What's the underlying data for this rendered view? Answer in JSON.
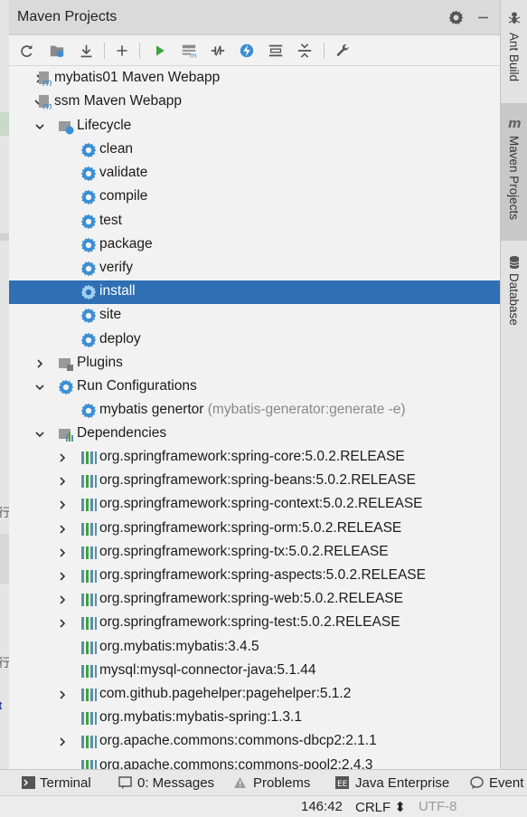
{
  "panel": {
    "title": "Maven Projects",
    "title_icons": [
      "gear-icon",
      "minimize-icon"
    ],
    "toolbar": [
      "reimport-icon",
      "generate-sources-icon",
      "download-icon",
      "add-icon",
      "run-icon",
      "execute-goal-icon",
      "toggle-offline-icon",
      "skip-tests-icon",
      "show-dependencies-icon",
      "collapse-all-icon",
      "settings-wrench-icon"
    ]
  },
  "tree": {
    "projects": [
      {
        "label": "mybatis01 Maven Webapp",
        "expanded": false
      },
      {
        "label": "ssm Maven Webapp",
        "expanded": true
      }
    ],
    "lifecycle": {
      "label": "Lifecycle",
      "goals": [
        "clean",
        "validate",
        "compile",
        "test",
        "package",
        "verify",
        "install",
        "site",
        "deploy"
      ],
      "selected": "install"
    },
    "plugins": {
      "label": "Plugins"
    },
    "run_configurations": {
      "label": "Run Configurations",
      "items": [
        {
          "label": "mybatis genertor",
          "hint": "(mybatis-generator:generate -e)"
        }
      ]
    },
    "dependencies": {
      "label": "Dependencies",
      "items": [
        {
          "label": "org.springframework:spring-core:5.0.2.RELEASE",
          "expandable": true
        },
        {
          "label": "org.springframework:spring-beans:5.0.2.RELEASE",
          "expandable": true
        },
        {
          "label": "org.springframework:spring-context:5.0.2.RELEASE",
          "expandable": true
        },
        {
          "label": "org.springframework:spring-orm:5.0.2.RELEASE",
          "expandable": true
        },
        {
          "label": "org.springframework:spring-tx:5.0.2.RELEASE",
          "expandable": true
        },
        {
          "label": "org.springframework:spring-aspects:5.0.2.RELEASE",
          "expandable": true
        },
        {
          "label": "org.springframework:spring-web:5.0.2.RELEASE",
          "expandable": true
        },
        {
          "label": "org.springframework:spring-test:5.0.2.RELEASE",
          "expandable": true
        },
        {
          "label": "org.mybatis:mybatis:3.4.5",
          "expandable": false
        },
        {
          "label": "mysql:mysql-connector-java:5.1.44",
          "expandable": false
        },
        {
          "label": "com.github.pagehelper:pagehelper:5.1.2",
          "expandable": true
        },
        {
          "label": "org.mybatis:mybatis-spring:1.3.1",
          "expandable": false
        },
        {
          "label": "org.apache.commons:commons-dbcp2:2.1.1",
          "expandable": true
        },
        {
          "label": "org.apache.commons:commons-pool2:2.4.3",
          "expandable": false
        }
      ]
    }
  },
  "right_tabs": [
    {
      "label": "Ant Build",
      "icon": "ant-icon",
      "active": false
    },
    {
      "label": "Maven Projects",
      "icon": "maven-icon",
      "active": true
    },
    {
      "label": "Database",
      "icon": "database-icon",
      "active": false
    }
  ],
  "bottom_tabs": [
    {
      "label": "Terminal",
      "icon": "terminal-icon"
    },
    {
      "label": "0: Messages",
      "icon": "messages-icon"
    },
    {
      "label": "Problems",
      "icon": "warning-icon"
    },
    {
      "label": "Java Enterprise",
      "icon": "java-enterprise-icon"
    },
    {
      "label": "Event",
      "icon": "event-log-icon"
    }
  ],
  "status": {
    "position": "146:42",
    "line_separator": "CRLF ⬍",
    "encoding": "UTF-8"
  },
  "left_strip_chars": [
    "行",
    "行",
    "t"
  ],
  "colors": {
    "selection": "#2f6fb4",
    "gear_icon": "#3b8fd4",
    "run_icon": "#3da33d",
    "dependency_bars": "#5a8fa8"
  }
}
